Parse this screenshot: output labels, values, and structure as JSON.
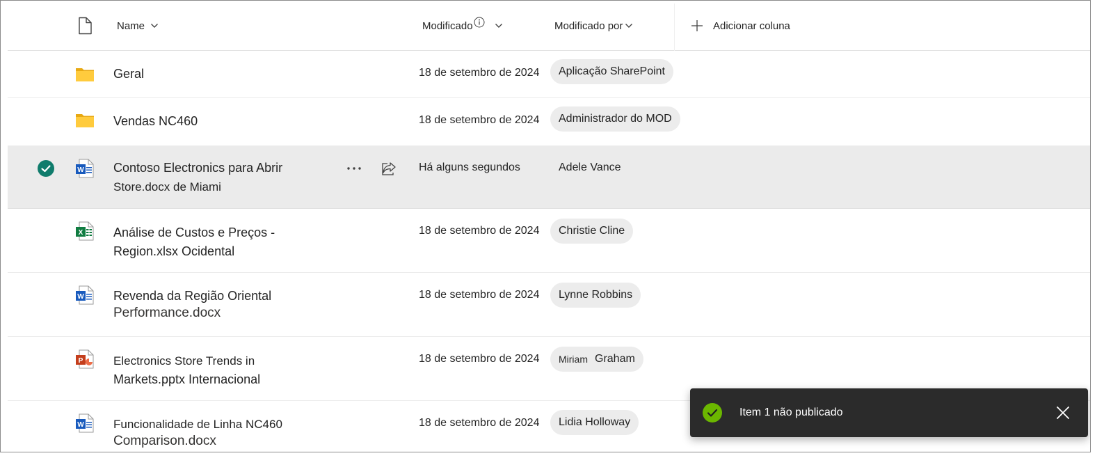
{
  "header": {
    "name_label": "Name",
    "modified_label": "Modificado",
    "modified_by_label": "Modificado por",
    "add_column_label": "Adicionar coluna"
  },
  "rows": [
    {
      "type": "folder",
      "name_line1": "Geral",
      "name_line2": "",
      "modified": "18 de setembro de 2024",
      "modified_by": "Aplicação SharePoint"
    },
    {
      "type": "folder",
      "name_line1": "Vendas NC460",
      "name_line2": "",
      "modified": "18 de setembro de 2024",
      "modified_by": "Administrador do MOD"
    },
    {
      "type": "word",
      "name_line1": "Contoso Electronics para Abrir",
      "name_line2": "Store.docx de Miami",
      "modified": "Há alguns segundos",
      "modified_by": "Adele Vance",
      "selected": true
    },
    {
      "type": "excel",
      "name_line1": "Análise de Custos e Preços -",
      "name_line2": "Region.xlsx Ocidental",
      "modified": "18 de setembro de 2024",
      "modified_by": "Christie Cline"
    },
    {
      "type": "word",
      "name_line1": "Revenda da Região Oriental",
      "name_line2": "Performance.docx",
      "modified": "18 de setembro de 2024",
      "modified_by": "Lynne Robbins"
    },
    {
      "type": "powerpoint",
      "name_line1": "Electronics Store Trends in",
      "name_line2": "Markets.pptx Internacional",
      "modified": "18 de setembro de 2024",
      "modified_by_first": "Miriam",
      "modified_by_last": "Graham"
    },
    {
      "type": "word",
      "name_line1": "Funcionalidade de Linha NC460",
      "name_line2": "Comparison.docx",
      "modified": "18 de setembro de 2024",
      "modified_by": "Lidia Holloway"
    }
  ],
  "toast": {
    "message": "Item 1 não publicado"
  },
  "colors": {
    "folder": "#f7c325",
    "word": "#185abd",
    "excel": "#107c41",
    "powerpoint": "#c43e1c",
    "check_selected": "#107c6c",
    "toast_check": "#6bb700",
    "toast_bg": "#2b2b2b"
  },
  "icons": [
    "file-icon",
    "chevron-down-icon",
    "info-icon",
    "plus-icon",
    "folder-icon",
    "word-file-icon",
    "excel-file-icon",
    "powerpoint-file-icon",
    "checkmark-circle-icon",
    "more-options-icon",
    "share-icon",
    "close-icon"
  ]
}
